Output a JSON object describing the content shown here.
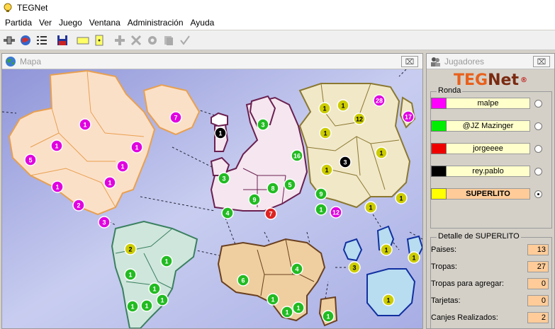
{
  "window": {
    "title": "TEGNet"
  },
  "menu": [
    "Partida",
    "Ver",
    "Juego",
    "Ventana",
    "Administración",
    "Ayuda"
  ],
  "toolbar": {
    "icons": [
      "connect-icon",
      "globe-icon",
      "list-icon",
      "save-icon",
      "yellow-card-icon",
      "yellow-dice-icon",
      "plus-icon",
      "cross-icon",
      "gear-icon",
      "copy-icon",
      "check-icon"
    ]
  },
  "map_window": {
    "title": "Mapa",
    "close_label": "⌧",
    "colors": {
      "ocean": "#c8cdf0",
      "north_america": "#fbe0c8",
      "south_america": "#cfe6dc",
      "europe": "#f5e6f0",
      "africa": "#efcf9f",
      "asia": "#f1e8c8",
      "oceania": "#b8dcf0"
    },
    "armies": [
      {
        "v": "1",
        "color": "#e000e0"
      },
      {
        "v": "7",
        "color": "#e000e0"
      },
      {
        "v": "1",
        "color": "#e000e0"
      },
      {
        "v": "5",
        "color": "#e000e0"
      },
      {
        "v": "1",
        "color": "#e000e0"
      },
      {
        "v": "1",
        "color": "#e000e0"
      },
      {
        "v": "1",
        "color": "#e000e0"
      },
      {
        "v": "1",
        "color": "#e000e0"
      },
      {
        "v": "2",
        "color": "#e000e0"
      },
      {
        "v": "3",
        "color": "#e000e0"
      },
      {
        "v": "1",
        "color": "#000000"
      },
      {
        "v": "3",
        "color": "#22bb22"
      },
      {
        "v": "16",
        "color": "#22bb22"
      },
      {
        "v": "3",
        "color": "#22bb22"
      },
      {
        "v": "9",
        "color": "#22bb22"
      },
      {
        "v": "8",
        "color": "#22bb22"
      },
      {
        "v": "5",
        "color": "#22bb22"
      },
      {
        "v": "4",
        "color": "#22bb22"
      },
      {
        "v": "7",
        "color": "#dd2222"
      },
      {
        "v": "9",
        "color": "#22bb22"
      },
      {
        "v": "1",
        "color": "#22bb22"
      },
      {
        "v": "12",
        "color": "#e000e0"
      },
      {
        "v": "1",
        "color": "#cccc00"
      },
      {
        "v": "1",
        "color": "#cccc00"
      },
      {
        "v": "28",
        "color": "#e000e0"
      },
      {
        "v": "12",
        "color": "#cccc00"
      },
      {
        "v": "17",
        "color": "#e000e0"
      },
      {
        "v": "1",
        "color": "#cccc00"
      },
      {
        "v": "1",
        "color": "#cccc00"
      },
      {
        "v": "3",
        "color": "#000000"
      },
      {
        "v": "1",
        "color": "#cccc00"
      },
      {
        "v": "1",
        "color": "#cccc00"
      },
      {
        "v": "1",
        "color": "#cccc00"
      },
      {
        "v": "2",
        "color": "#cccc00"
      },
      {
        "v": "1",
        "color": "#22bb22"
      },
      {
        "v": "1",
        "color": "#22bb22"
      },
      {
        "v": "1",
        "color": "#22bb22"
      },
      {
        "v": "1",
        "color": "#22bb22"
      },
      {
        "v": "1",
        "color": "#22bb22"
      },
      {
        "v": "1",
        "color": "#22bb22"
      },
      {
        "v": "4",
        "color": "#22bb22"
      },
      {
        "v": "6",
        "color": "#22bb22"
      },
      {
        "v": "1",
        "color": "#22bb22"
      },
      {
        "v": "1",
        "color": "#22bb22"
      },
      {
        "v": "1",
        "color": "#22bb22"
      },
      {
        "v": "1",
        "color": "#22bb22"
      },
      {
        "v": "3",
        "color": "#cccc00"
      },
      {
        "v": "1",
        "color": "#cccc00"
      },
      {
        "v": "1",
        "color": "#cccc00"
      },
      {
        "v": "1",
        "color": "#cccc00"
      }
    ]
  },
  "players_window": {
    "title": "Jugadores",
    "close_label": "⌧",
    "logo_teg": "TEG",
    "logo_net": "Net",
    "logo_reg": "®",
    "ronda_label": "Ronda",
    "players": [
      {
        "name": "malpe",
        "color": "#ff00ff",
        "selected": false
      },
      {
        "name": "@JZ Mazinger",
        "color": "#00ee00",
        "selected": false
      },
      {
        "name": "jorgeeee",
        "color": "#ee0000",
        "selected": false
      },
      {
        "name": "rey.pablo",
        "color": "#000000",
        "selected": false
      },
      {
        "name": "SUPERLITO",
        "color": "#ffff00",
        "selected": true
      }
    ],
    "detail_label": "Detalle de SUPERLITO",
    "details": [
      {
        "label": "Paises:",
        "value": "13"
      },
      {
        "label": "Tropas:",
        "value": "27"
      },
      {
        "label": "Tropas para agregar:",
        "value": "0"
      },
      {
        "label": "Tarjetas:",
        "value": "0"
      },
      {
        "label": "Canjes Realizados:",
        "value": "2"
      }
    ]
  }
}
